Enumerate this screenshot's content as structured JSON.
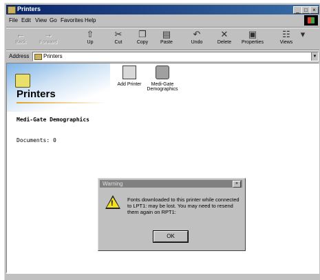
{
  "window": {
    "title": "Printers"
  },
  "menu": [
    "File",
    "Edit",
    "View",
    "Go",
    "Favorites",
    "Help"
  ],
  "toolbar": [
    {
      "label": "Back",
      "icon": "back-arrow-icon",
      "disabled": true
    },
    {
      "label": "Forward",
      "icon": "forward-arrow-icon",
      "disabled": true
    },
    {
      "label": "Up",
      "icon": "up-folder-icon"
    },
    {
      "label": "Cut",
      "icon": "scissors-icon"
    },
    {
      "label": "Copy",
      "icon": "copy-icon"
    },
    {
      "label": "Paste",
      "icon": "paste-icon"
    },
    {
      "label": "Undo",
      "icon": "undo-icon"
    },
    {
      "label": "Delete",
      "icon": "delete-x-icon"
    },
    {
      "label": "Properties",
      "icon": "properties-icon"
    },
    {
      "label": "Views",
      "icon": "views-icon"
    }
  ],
  "address": {
    "label": "Address",
    "value": "Printers"
  },
  "banner": {
    "title": "Printers"
  },
  "selection": {
    "name": "Medi-Gate Demographics",
    "documents": "Documents: 0"
  },
  "items": [
    {
      "label": "Add Printer"
    },
    {
      "label": "Medi-Gate Demographics"
    }
  ],
  "dialog": {
    "title": "Warning",
    "message": "Fonts downloaded to this printer while connected to LPT1: may be lost. You may need to resend them again on RPT1:",
    "ok": "OK"
  }
}
